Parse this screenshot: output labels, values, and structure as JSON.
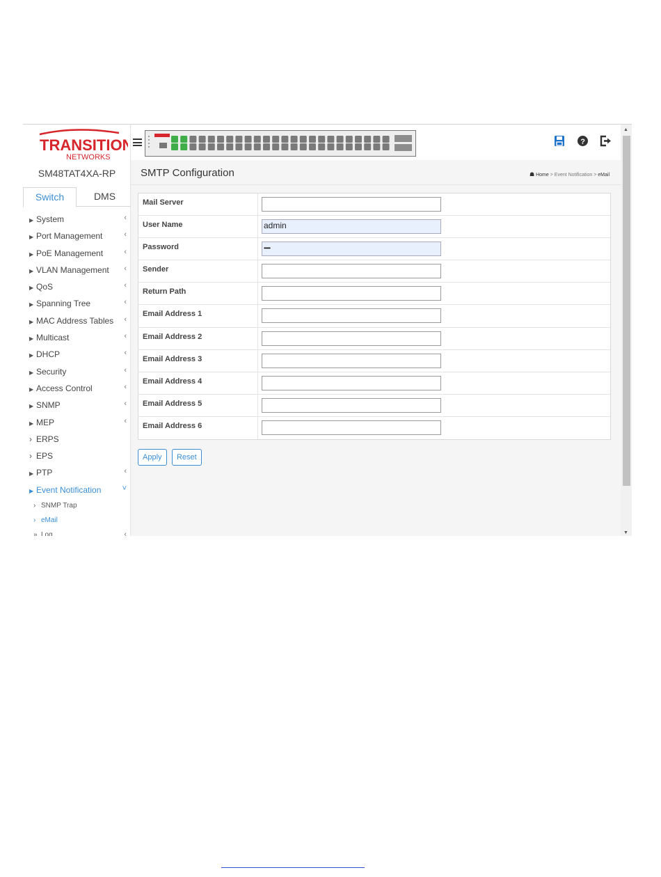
{
  "brand": {
    "logo_line1": "TRANSITION",
    "logo_line2": "NETWORKS",
    "model": "SM48TAT4XA-RP"
  },
  "tabs": [
    {
      "label": "Switch"
    },
    {
      "label": "DMS"
    }
  ],
  "menu": [
    {
      "label": "System"
    },
    {
      "label": "Port Management"
    },
    {
      "label": "PoE Management"
    },
    {
      "label": "VLAN Management"
    },
    {
      "label": "QoS"
    },
    {
      "label": "Spanning Tree"
    },
    {
      "label": "MAC Address Tables"
    },
    {
      "label": "Multicast"
    },
    {
      "label": "DHCP"
    },
    {
      "label": "Security"
    },
    {
      "label": "Access Control"
    },
    {
      "label": "SNMP"
    },
    {
      "label": "MEP"
    },
    {
      "label": "ERPS"
    },
    {
      "label": "EPS"
    },
    {
      "label": "PTP"
    },
    {
      "label": "Event Notification"
    }
  ],
  "submenu": [
    {
      "label": "SNMP Trap"
    },
    {
      "label": "eMail"
    },
    {
      "label": "Log"
    }
  ],
  "page": {
    "title": "SMTP Configuration",
    "breadcrumb": {
      "home": "Home",
      "section": "Event Notification",
      "current": "eMail"
    }
  },
  "form": {
    "rows": [
      {
        "label": "Mail Server",
        "value": ""
      },
      {
        "label": "User Name",
        "value": "admin"
      },
      {
        "label": "Password",
        "value": "•••••"
      },
      {
        "label": "Sender",
        "value": ""
      },
      {
        "label": "Return Path",
        "value": ""
      },
      {
        "label": "Email Address 1",
        "value": ""
      },
      {
        "label": "Email Address 2",
        "value": ""
      },
      {
        "label": "Email Address 3",
        "value": ""
      },
      {
        "label": "Email Address 4",
        "value": ""
      },
      {
        "label": "Email Address 5",
        "value": ""
      },
      {
        "label": "Email Address 6",
        "value": ""
      }
    ],
    "apply_label": "Apply",
    "reset_label": "Reset"
  },
  "icons": {
    "save": "save-icon",
    "help": "help-icon",
    "logout": "logout-icon",
    "menu": "menu-icon"
  },
  "colors": {
    "accent": "#3b8ed4",
    "logo_red": "#d6252b",
    "port_active": "#3fae49",
    "icon_blue": "#1f73c8"
  }
}
